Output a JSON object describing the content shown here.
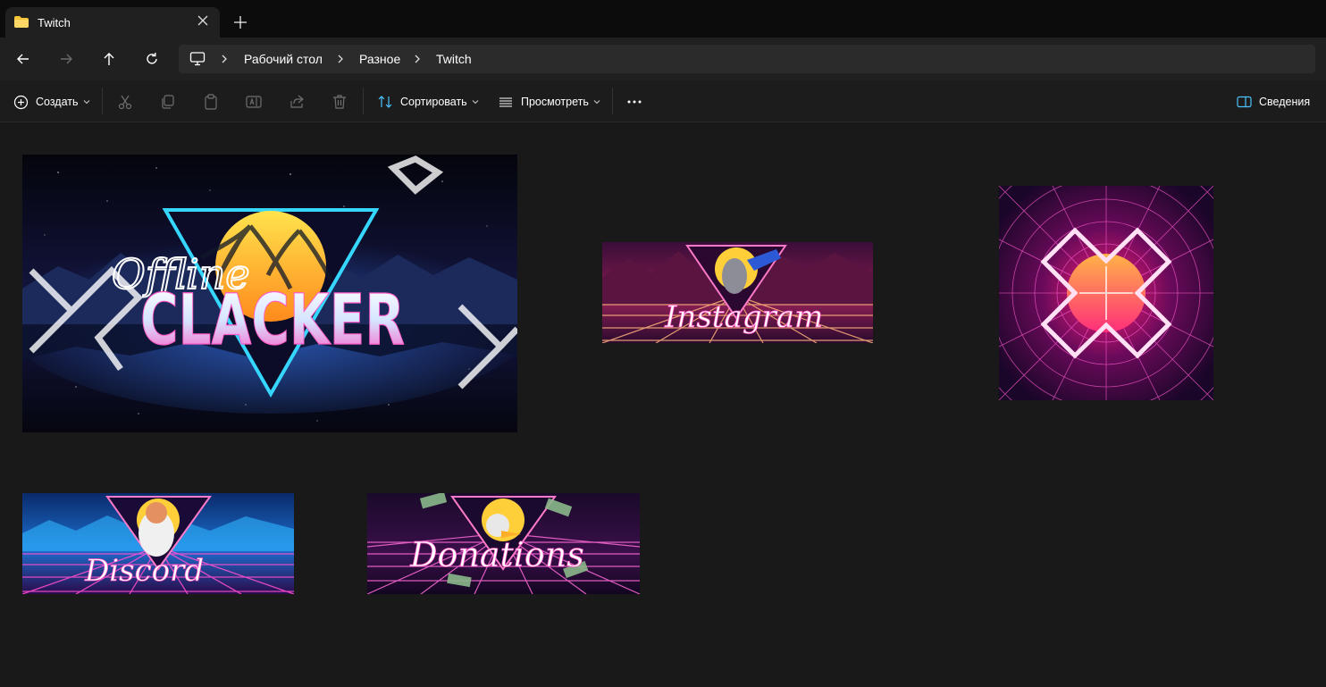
{
  "window": {
    "tab_title": "Twitch"
  },
  "breadcrumb": [
    "Рабочий стол",
    "Разное",
    "Twitch"
  ],
  "toolbar": {
    "create_label": "Создать",
    "sort_label": "Сортировать",
    "view_label": "Просмотреть",
    "details_label": "Сведения"
  },
  "thumbnails": [
    {
      "title": "Offline",
      "subtitle": "CLACKER"
    },
    {
      "title": "Instagram"
    },
    {
      "title": "Discord"
    },
    {
      "title": "Donations"
    }
  ],
  "colors": {
    "accent": "#ffd24a",
    "neon_pink": "#ff2fa8",
    "neon_cyan": "#2fe0ff"
  }
}
